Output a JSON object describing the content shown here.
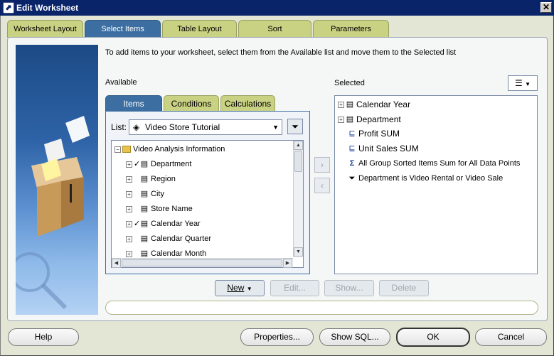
{
  "window": {
    "title": "Edit Worksheet",
    "close_glyph": "✕"
  },
  "tabs": [
    {
      "label": "Worksheet Layout"
    },
    {
      "label": "Select Items"
    },
    {
      "label": "Table Layout"
    },
    {
      "label": "Sort"
    },
    {
      "label": "Parameters"
    }
  ],
  "instructions": "To add items to your worksheet, select them from the Available list and move them to the Selected list",
  "available": {
    "label": "Available",
    "subtabs": [
      {
        "label": "Items"
      },
      {
        "label": "Conditions"
      },
      {
        "label": "Calculations"
      }
    ],
    "list_label": "List:",
    "list_value": "Video Store Tutorial",
    "tree": [
      {
        "label": "Video Analysis Information",
        "level": 0,
        "checked": false,
        "icon": "folder-icon"
      },
      {
        "label": "Department",
        "level": 1,
        "checked": true,
        "icon": "item-icon"
      },
      {
        "label": "Region",
        "level": 1,
        "checked": false,
        "icon": "item-icon"
      },
      {
        "label": "City",
        "level": 1,
        "checked": false,
        "icon": "item-icon"
      },
      {
        "label": "Store Name",
        "level": 1,
        "checked": false,
        "icon": "item-icon"
      },
      {
        "label": "Calendar Year",
        "level": 1,
        "checked": true,
        "icon": "item-icon"
      },
      {
        "label": "Calendar Quarter",
        "level": 1,
        "checked": false,
        "icon": "item-icon"
      },
      {
        "label": "Calendar Month",
        "level": 1,
        "checked": false,
        "icon": "item-icon"
      }
    ]
  },
  "selected": {
    "label": "Selected",
    "items": [
      {
        "label": "Calendar Year",
        "icon": "item-icon",
        "expandable": true
      },
      {
        "label": "Department",
        "icon": "item-icon",
        "expandable": true
      },
      {
        "label": "Profit SUM",
        "icon": "measure-icon",
        "expandable": false
      },
      {
        "label": "Unit Sales SUM",
        "icon": "measure-icon",
        "expandable": false
      },
      {
        "label": "All Group Sorted Items Sum for All Data Points",
        "icon": "sigma-icon",
        "expandable": false
      },
      {
        "label": "Department is Video Rental or Video Sale",
        "icon": "filter-icon",
        "expandable": false
      }
    ]
  },
  "actions": {
    "new": "New",
    "edit": "Edit...",
    "show": "Show...",
    "delete": "Delete"
  },
  "footer": {
    "help": "Help",
    "properties": "Properties...",
    "show_sql": "Show SQL...",
    "ok": "OK",
    "cancel": "Cancel"
  }
}
